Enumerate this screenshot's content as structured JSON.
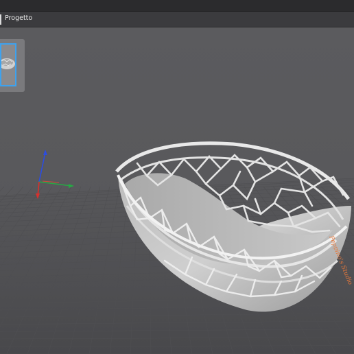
{
  "window": {
    "title": ""
  },
  "tabs": [
    {
      "label": "Progetto",
      "active": true
    }
  ],
  "viewport": {
    "model_name": "bowl",
    "model_label": "Peppino's Studio",
    "axes": {
      "x_color": "#d9302c",
      "y_color": "#27a845",
      "z_color": "#2c4de0"
    }
  },
  "thumbnails": [
    {
      "name": "bowl-thumbnail",
      "selected": true,
      "accent_color": "#3ea2ee"
    }
  ],
  "colors": {
    "background": "#57575a",
    "grid": "#4a4a4d",
    "model": "#d8d8d8",
    "label": "#e8783a"
  }
}
